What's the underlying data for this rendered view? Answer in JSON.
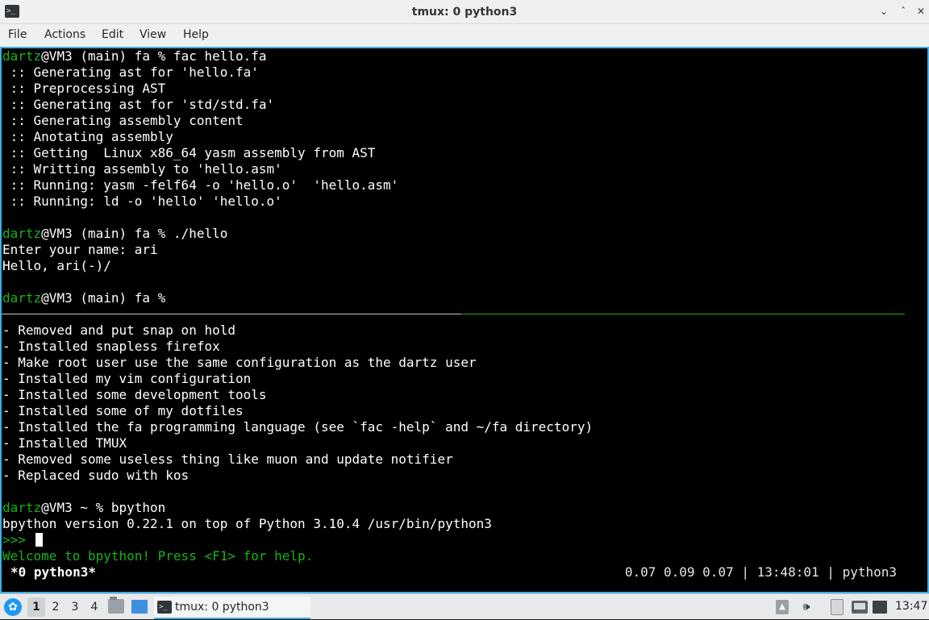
{
  "window": {
    "title": "tmux: 0 python3",
    "icon": "terminal-icon",
    "controls": {
      "minimize": "minimize-icon",
      "maximize": "maximize-icon",
      "close": "close-icon"
    }
  },
  "menubar": {
    "items": [
      "File",
      "Actions",
      "Edit",
      "View",
      "Help"
    ]
  },
  "terminal": {
    "prompt_user": "dartz",
    "top_pane": {
      "cmd1_prompt": "@VM3 (main) fa % fac hello.fa",
      "build_output": [
        " :: Generating ast for 'hello.fa'",
        " :: Preprocessing AST",
        " :: Generating ast for 'std/std.fa'",
        " :: Generating assembly content",
        " :: Anotating assembly",
        " :: Getting  Linux x86_64 yasm assembly from AST",
        " :: Writting assembly to 'hello.asm'",
        " :: Running: yasm -felf64 -o 'hello.o'  'hello.asm'",
        " :: Running: ld -o 'hello' 'hello.o'"
      ],
      "cmd2_prompt": "@VM3 (main) fa % ./hello",
      "program_output": [
        "Enter your name: ari",
        "Hello, ari(-)/"
      ],
      "cmd3_prompt": "@VM3 (main) fa %"
    },
    "bottom_pane": {
      "notes": [
        "- Removed and put snap on hold",
        "- Installed snapless firefox",
        "- Make root user use the same configuration as the dartz user",
        "- Installed my vim configuration",
        "- Installed some development tools",
        "- Installed some of my dotfiles",
        "- Installed the fa programming language (see `fac -help` and ~/fa directory)",
        "- Installed TMUX",
        "- Removed some useless thing like muon and update notifier",
        "- Replaced sudo with kos"
      ],
      "cmd_prompt": "@VM3 ~ % bpython",
      "bpython_version": "bpython version 0.22.1 on top of Python 3.10.4 /usr/bin/python3",
      "repl_prompt": ">>> ",
      "welcome": "Welcome to bpython! Press <F1> for help."
    },
    "status_bar": {
      "window_label": "*0 python3*",
      "right_info": "0.07 0.09 0.07 | 13:48:01 | python3"
    }
  },
  "taskbar": {
    "launcher_icon": "application-launcher-icon",
    "desktops": [
      "1",
      "2",
      "3",
      "4"
    ],
    "active_desktop": "1",
    "task_title": "tmux: 0 python3",
    "tray_icons": [
      "show-hidden-icon",
      "volume-icon",
      "clipboard-icon",
      "network-icon",
      "display-icon"
    ],
    "clock": "13:47"
  },
  "colors": {
    "prompt_user": "#18b218",
    "focus_border": "#3daee9",
    "terminal_bg": "#000000",
    "active_pane_divider": "#18b218"
  }
}
